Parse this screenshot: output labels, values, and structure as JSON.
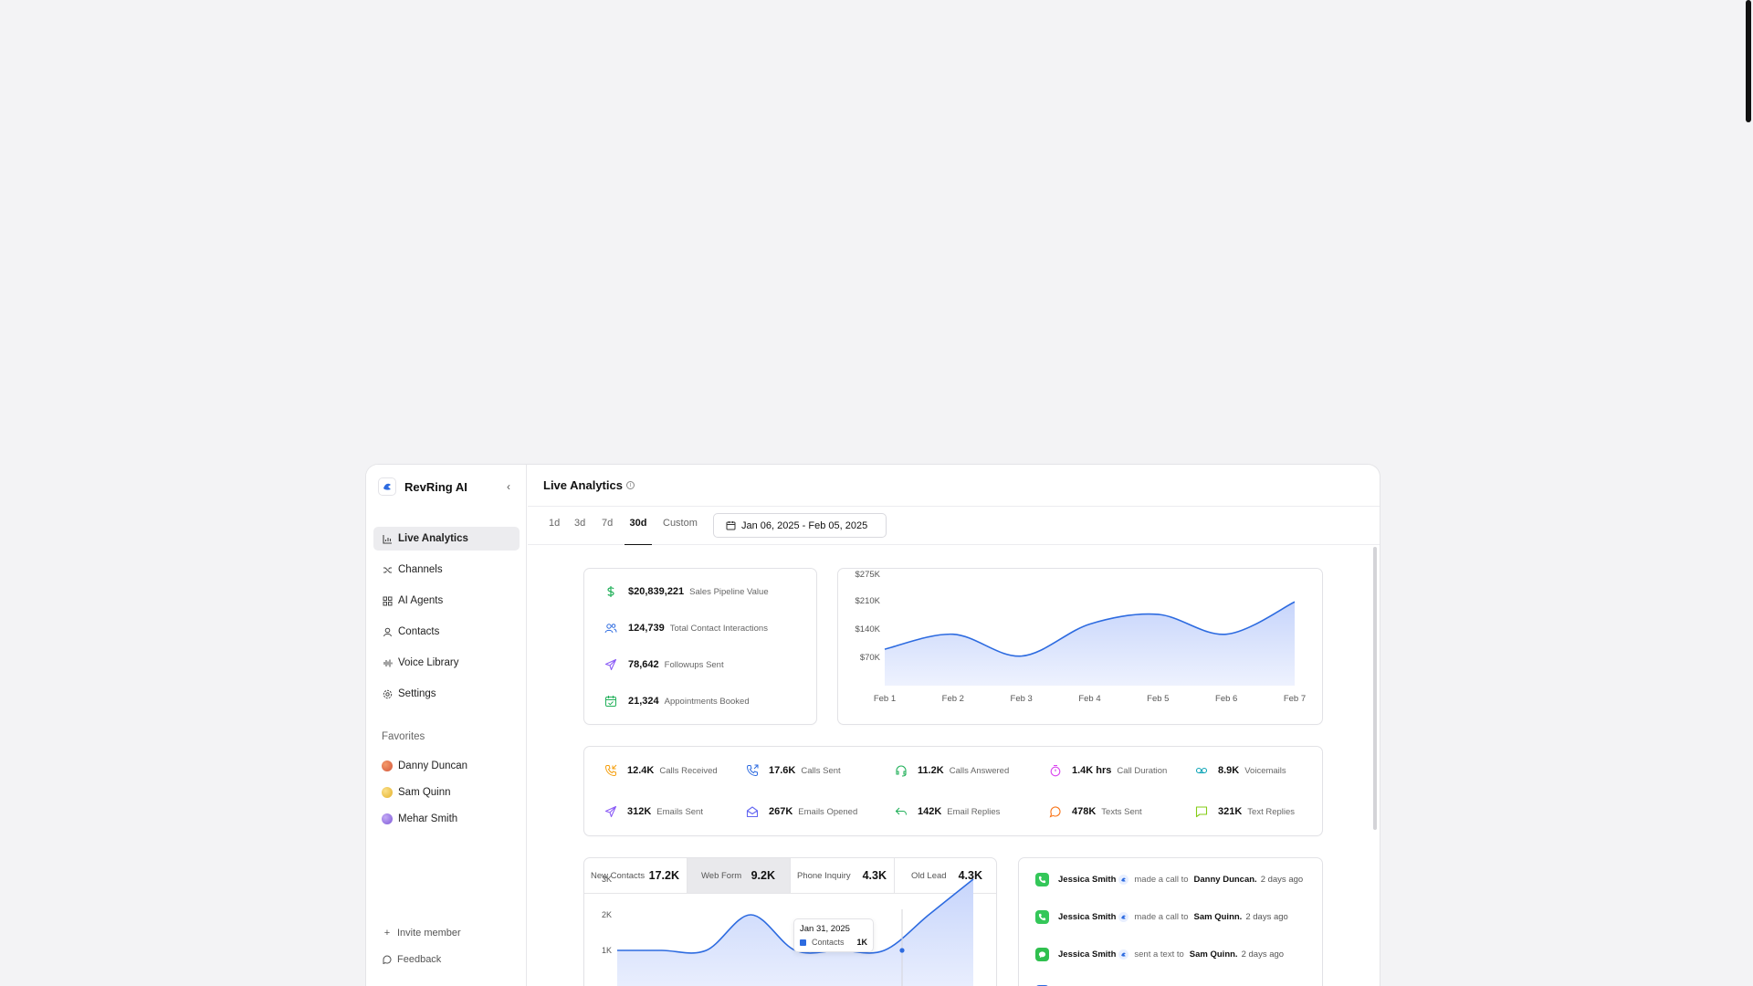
{
  "colors": {
    "accent": "#2d6be0",
    "area_fill": "#dfe7ff",
    "green": "#22b05a",
    "purple": "#8b5cf6",
    "orange": "#f59e0b"
  },
  "sidebar": {
    "brand": "RevRing AI",
    "collapse_icon": "chevron-left-icon",
    "items": [
      {
        "label": "Live Analytics",
        "icon": "bar-chart-icon",
        "active": true
      },
      {
        "label": "Channels",
        "icon": "shuffle-icon"
      },
      {
        "label": "AI Agents",
        "icon": "agents-grid-icon"
      },
      {
        "label": "Contacts",
        "icon": "user-icon"
      },
      {
        "label": "Voice Library",
        "icon": "audio-wave-icon"
      },
      {
        "label": "Settings",
        "icon": "gear-icon"
      }
    ],
    "favorites_title": "Favorites",
    "favorites": [
      {
        "name": "Danny Duncan",
        "color": "#e36f4b"
      },
      {
        "name": "Sam Quinn",
        "color": "#f2c94c"
      },
      {
        "name": "Mehar Smith",
        "color": "#9b7bea"
      }
    ],
    "bottom": {
      "invite": "Invite member",
      "feedback": "Feedback"
    }
  },
  "header": {
    "title": "Live Analytics"
  },
  "ranges": {
    "tabs": [
      "1d",
      "3d",
      "7d",
      "30d",
      "Custom"
    ],
    "active": "30d",
    "date_range": "Jan 06, 2025 - Feb 05, 2025"
  },
  "kpis": [
    {
      "value": "$20,839,221",
      "label": "Sales Pipeline Value",
      "icon": "dollar-icon"
    },
    {
      "value": "124,739",
      "label": "Total Contact Interactions",
      "icon": "users-icon"
    },
    {
      "value": "78,642",
      "label": "Followups Sent",
      "icon": "send-icon"
    },
    {
      "value": "21,324",
      "label": "Appointments Booked",
      "icon": "calendar-check-icon"
    }
  ],
  "metrics": [
    {
      "value": "12.4K",
      "label": "Calls Received",
      "icon": "phone-incoming-icon",
      "color": "#f59e0b"
    },
    {
      "value": "17.6K",
      "label": "Calls Sent",
      "icon": "phone-outgoing-icon",
      "color": "#2d6be0"
    },
    {
      "value": "11.2K",
      "label": "Calls Answered",
      "icon": "headset-icon",
      "color": "#22b05a"
    },
    {
      "value": "1.4K hrs",
      "label": "Call Duration",
      "icon": "timer-icon",
      "color": "#d946ef"
    },
    {
      "value": "8.9K",
      "label": "Voicemails",
      "icon": "voicemail-icon",
      "color": "#0ea5b7"
    },
    {
      "value": "312K",
      "label": "Emails Sent",
      "icon": "send-icon",
      "color": "#8b5cf6"
    },
    {
      "value": "267K",
      "label": "Emails Opened",
      "icon": "mail-open-icon",
      "color": "#6366f1"
    },
    {
      "value": "142K",
      "label": "Email Replies",
      "icon": "reply-icon",
      "color": "#22b05a"
    },
    {
      "value": "478K",
      "label": "Texts Sent",
      "icon": "chat-bubble-icon",
      "color": "#f97316"
    },
    {
      "value": "321K",
      "label": "Text Replies",
      "icon": "message-square-icon",
      "color": "#84cc16"
    }
  ],
  "contact_tabs": [
    {
      "label": "New Contacts",
      "value": "17.2K"
    },
    {
      "label": "Web Form",
      "value": "9.2K",
      "active": true
    },
    {
      "label": "Phone Inquiry",
      "value": "4.3K"
    },
    {
      "label": "Old Lead",
      "value": "4.3K"
    }
  ],
  "tooltip": {
    "date": "Jan 31, 2025",
    "series": "Contacts",
    "value": "1K"
  },
  "activity": [
    {
      "name": "Jessica Smith",
      "verb": "made a call to",
      "target": "Danny Duncan.",
      "time": "2 days ago",
      "icon": "phone-icon"
    },
    {
      "name": "Jessica Smith",
      "verb": "made a call to",
      "target": "Sam Quinn.",
      "time": "2 days ago",
      "icon": "phone-icon"
    },
    {
      "name": "Jessica Smith",
      "verb": "sent a text to",
      "target": "Sam Quinn.",
      "time": "2 days ago",
      "icon": "message-icon"
    }
  ],
  "chart_data": [
    {
      "type": "area",
      "x": [
        "Feb 1",
        "Feb 2",
        "Feb 3",
        "Feb 4",
        "Feb 5",
        "Feb 6",
        "Feb 7"
      ],
      "values": [
        90000,
        127000,
        73000,
        152000,
        176000,
        127000,
        207000
      ],
      "yticks": [
        "$70K",
        "$140K",
        "$210K",
        "$275K"
      ],
      "ytick_values": [
        70000,
        140000,
        210000,
        275000
      ]
    },
    {
      "type": "area",
      "series": [
        {
          "name": "Contacts",
          "values": [
            1000,
            1000,
            1000,
            2000,
            1000,
            1000,
            1000,
            2000,
            3000
          ]
        }
      ],
      "yticks": [
        "3K",
        "2K",
        "1K"
      ],
      "ytick_values": [
        3000,
        2000,
        1000
      ]
    }
  ]
}
